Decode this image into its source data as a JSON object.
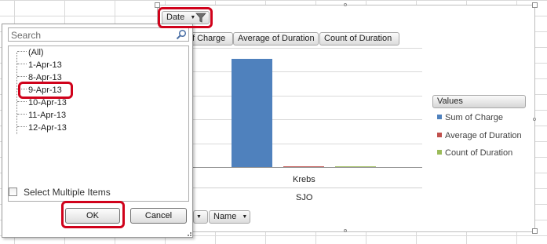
{
  "pivot_chart": {
    "filter_buttons": {
      "date": "Date",
      "sum_of_charge_partial": "f Charge",
      "average_of_duration": "Average of Duration",
      "count_of_duration": "Count of Duration"
    },
    "x_axis_labels": {
      "outer": "Krebs",
      "inner": "SJO"
    },
    "row_field_buttons": {
      "name": "Name"
    },
    "legend": {
      "title": "Values",
      "items": [
        {
          "label": "Sum of Charge",
          "color": "#4f81bd"
        },
        {
          "label": "Average of Duration",
          "color": "#c0504d"
        },
        {
          "label": "Count of Duration",
          "color": "#9bbb59"
        }
      ]
    }
  },
  "chart_data": {
    "type": "bar",
    "categories": [
      "Krebs / SJO"
    ],
    "series": [
      {
        "name": "Sum of Charge",
        "values": [
          100
        ]
      },
      {
        "name": "Average of Duration",
        "values": [
          1.5
        ]
      },
      {
        "name": "Count of Duration",
        "values": [
          1.5
        ]
      }
    ],
    "ylim": [
      0,
      110
    ],
    "grid": true,
    "legend_position": "right"
  },
  "filter_dropdown": {
    "search_placeholder": "Search",
    "items": [
      "(All)",
      "1-Apr-13",
      "8-Apr-13",
      "9-Apr-13",
      "10-Apr-13",
      "11-Apr-13",
      "12-Apr-13"
    ],
    "select_multiple_label": "Select Multiple Items",
    "ok_label": "OK",
    "cancel_label": "Cancel"
  }
}
